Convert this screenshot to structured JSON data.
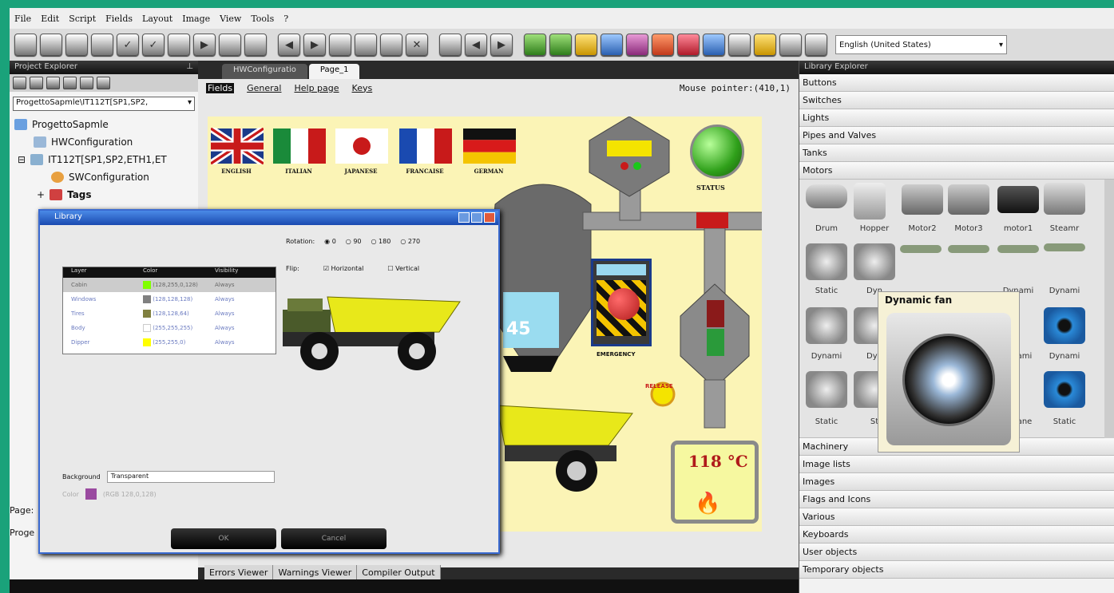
{
  "menu": [
    "File",
    "Edit",
    "Script",
    "Fields",
    "Layout",
    "Image",
    "View",
    "Tools",
    "?"
  ],
  "language": "English (United States)",
  "project_explorer": {
    "title": "Project Explorer",
    "combo": "ProgettoSapmle\\IT112T[SP1,SP2,",
    "tree": [
      "ProgettoSapmle",
      "HWConfiguration",
      "IT112T[SP1,SP2,ETH1,ET",
      "SWConfiguration",
      "Tags"
    ],
    "bottom": [
      "Page:",
      "Proge"
    ]
  },
  "editor": {
    "tabs": [
      "HWConfiguratio",
      "Page_1"
    ],
    "subnav": [
      "Fields",
      "General",
      "Help page",
      "Keys"
    ],
    "mouse": "Mouse pointer:(410,1)",
    "flags": [
      "ENGLISH",
      "ITALIAN",
      "JAPANESE",
      "FRANCAISE",
      "GERMAN"
    ],
    "status": "STATUS",
    "emergency": "EMERGENCY",
    "temperature": "118 °C",
    "gauge": "45",
    "bottom_tabs": [
      "Errors Viewer",
      "Warnings Viewer",
      "Compiler Output"
    ]
  },
  "library": {
    "title": "Library Explorer",
    "top_categories": [
      "Buttons",
      "Switches",
      "Lights",
      "Pipes and Valves",
      "Tanks",
      "Motors"
    ],
    "motor_labels": [
      "Drum",
      "Hopper",
      "Motor2",
      "Motor3",
      "motor1",
      "Steamr"
    ],
    "row2": [
      "Static",
      "Dyn",
      "Dynami",
      "Dynami"
    ],
    "row3": [
      "Dynami",
      "Dyn",
      "ami",
      "Dynami"
    ],
    "row4": [
      "Static",
      "St",
      "ane",
      "Static"
    ],
    "popup_title": "Dynamic fan",
    "bottom_categories": [
      "Machinery",
      "Image lists",
      "Images",
      "Flags and Icons",
      "Various",
      "Keyboards",
      "User objects",
      "Temporary objects"
    ]
  },
  "dialog": {
    "title": "Library",
    "rotation_label": "Rotation:",
    "rotations": [
      "0",
      "90",
      "180",
      "270"
    ],
    "flip_label": "Flip:",
    "flips": [
      "Horizontal",
      "Vertical"
    ],
    "layer_headers": [
      "Layer",
      "Color",
      "Visibility"
    ],
    "layers": [
      {
        "name": "Cabin",
        "color": "(128,255,0,128)",
        "vis": "Always"
      },
      {
        "name": "Windows",
        "color": "(128,128,128)",
        "vis": "Always"
      },
      {
        "name": "Tires",
        "color": "(128,128,64)",
        "vis": "Always"
      },
      {
        "name": "Body",
        "color": "(255,255,255)",
        "vis": "Always"
      },
      {
        "name": "Dipper",
        "color": "(255,255,0)",
        "vis": "Always"
      }
    ],
    "background_label": "Background",
    "background_value": "Transparent",
    "color_label": "Color",
    "color_value": "(RGB 128,0,128)",
    "ok": "OK",
    "cancel": "Cancel"
  }
}
